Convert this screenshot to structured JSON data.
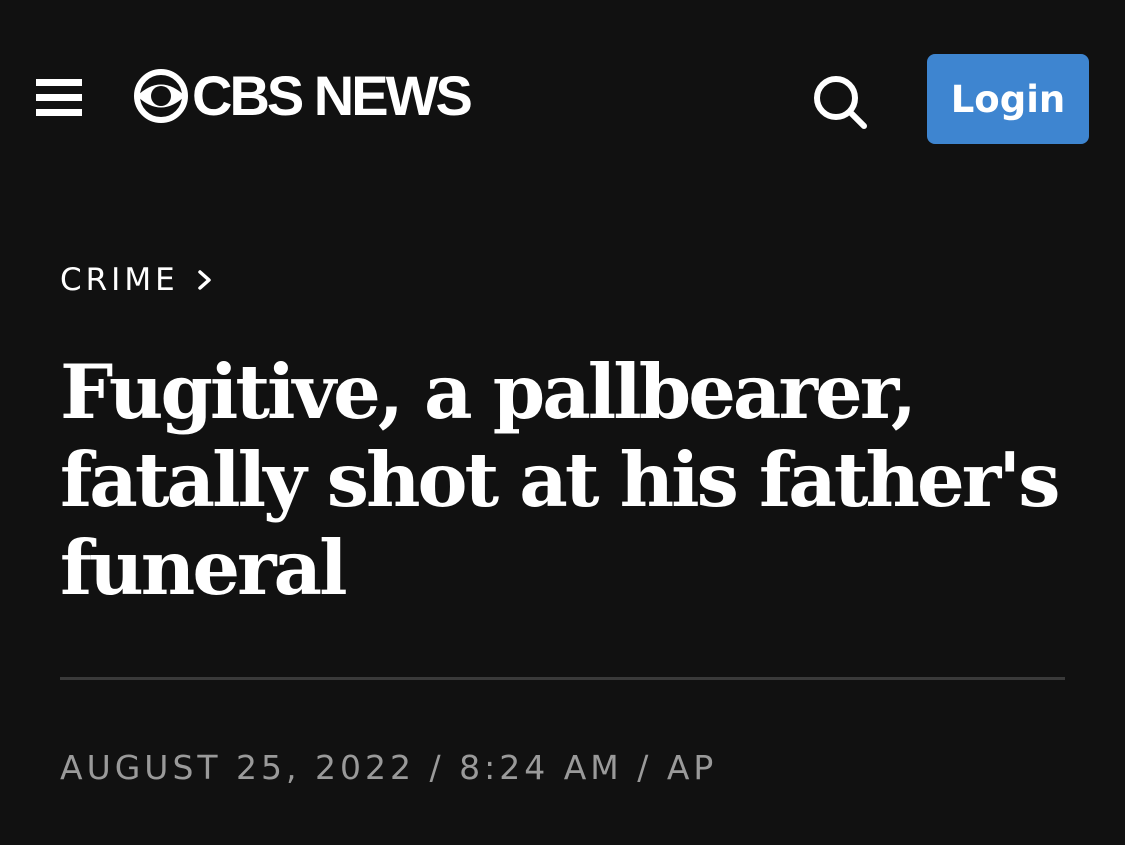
{
  "header": {
    "menu_icon": "hamburger-menu-icon",
    "logo_icon": "cbs-eye-icon",
    "logo_text": "CBS NEWS",
    "search_icon": "search-icon",
    "login_label": "Login",
    "login_color": "#3e85d0"
  },
  "article": {
    "category": "CRIME",
    "category_icon": "chevron-right-icon",
    "headline": "Fugitive, a pallbearer, fatally shot at his father's funeral",
    "byline": "AUGUST 25, 2022 / 8:24 AM / AP"
  },
  "colors": {
    "background": "#111111",
    "text": "#ffffff",
    "byline": "#9a9a9a",
    "divider": "#3a3a3a"
  }
}
